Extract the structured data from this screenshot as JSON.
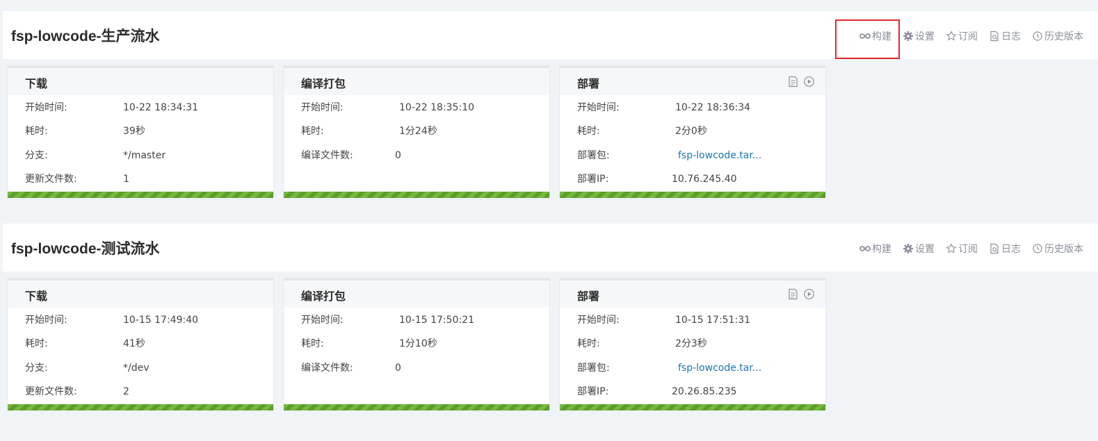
{
  "actions": {
    "build": "构建",
    "settings": "设置",
    "subscribe": "订阅",
    "log": "日志",
    "history": "历史版本"
  },
  "pipelines": [
    {
      "title": "fsp-lowcode-生产流水",
      "stages": {
        "download": {
          "name": "下载",
          "start_label": "开始时间:",
          "start": "10-22 18:34:31",
          "duration_label": "耗时:",
          "duration": "39秒",
          "branch_label": "分支:",
          "branch": "*/master",
          "files_label": "更新文件数:",
          "files": "1",
          "progress": 1.0
        },
        "build": {
          "name": "编译打包",
          "start_label": "开始时间:",
          "start": "10-22 18:35:10",
          "duration_label": "耗时:",
          "duration": "1分24秒",
          "files_label": "编译文件数:",
          "files": "0",
          "progress": 1.0
        },
        "deploy": {
          "name": "部署",
          "start_label": "开始时间:",
          "start": "10-22 18:36:34",
          "duration_label": "耗时:",
          "duration": "2分0秒",
          "package_label": "部署包:",
          "package": "fsp-lowcode.tar...",
          "ip_label": "部署IP:",
          "ip": "10.76.245.40",
          "progress": 1.0
        }
      }
    },
    {
      "title": "fsp-lowcode-测试流水",
      "stages": {
        "download": {
          "name": "下载",
          "start_label": "开始时间:",
          "start": "10-15 17:49:40",
          "duration_label": "耗时:",
          "duration": "41秒",
          "branch_label": "分支:",
          "branch": "*/dev",
          "files_label": "更新文件数:",
          "files": "2",
          "progress": 1.0
        },
        "build": {
          "name": "编译打包",
          "start_label": "开始时间:",
          "start": "10-15 17:50:21",
          "duration_label": "耗时:",
          "duration": "1分10秒",
          "files_label": "编译文件数:",
          "files": "0",
          "progress": 1.0
        },
        "deploy": {
          "name": "部署",
          "start_label": "开始时间:",
          "start": "10-15 17:51:31",
          "duration_label": "耗时:",
          "duration": "2分3秒",
          "package_label": "部署包:",
          "package": "fsp-lowcode.tar...",
          "ip_label": "部署IP:",
          "ip": "20.26.85.235",
          "progress": 1.0
        }
      }
    }
  ],
  "colors": {
    "accent_link": "#1a76b3",
    "success_bar": "#76b83f",
    "highlight": "#e0262b"
  }
}
